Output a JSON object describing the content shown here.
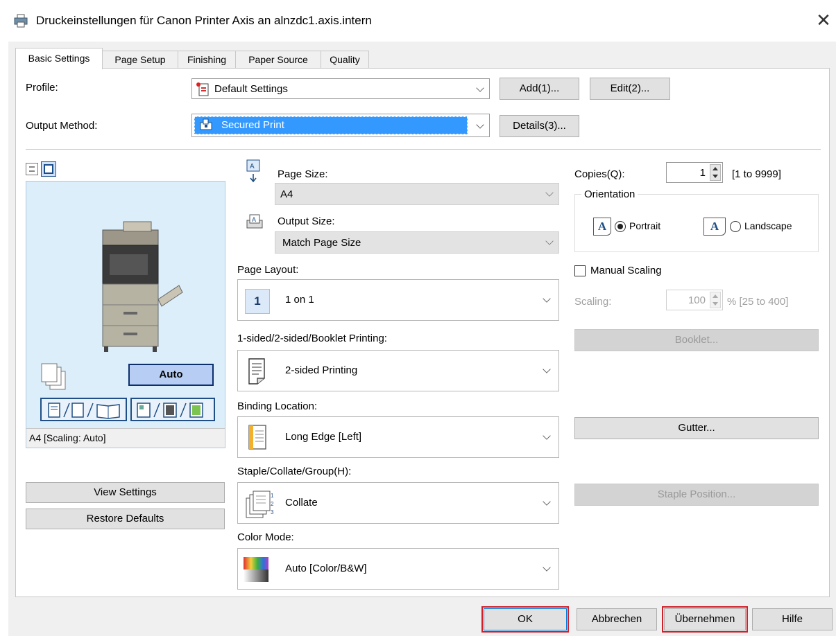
{
  "window": {
    "title": "Druckeinstellungen für Canon Printer Axis an alnzdc1.axis.intern",
    "close_label": "✕"
  },
  "tabs": [
    {
      "label": "Basic Settings",
      "active": true
    },
    {
      "label": "Page Setup"
    },
    {
      "label": "Finishing"
    },
    {
      "label": "Paper Source"
    },
    {
      "label": "Quality"
    }
  ],
  "profile": {
    "label": "Profile:",
    "value": "Default Settings",
    "add_button": "Add(1)...",
    "edit_button": "Edit(2)..."
  },
  "output_method": {
    "label": "Output Method:",
    "value": "Secured Print",
    "details_button": "Details(3)..."
  },
  "preview": {
    "auto_button": "Auto",
    "caption": "A4 [Scaling: Auto]",
    "view_settings_button": "View Settings",
    "restore_defaults_button": "Restore Defaults"
  },
  "page_size": {
    "label": "Page Size:",
    "value": "A4"
  },
  "output_size": {
    "label": "Output Size:",
    "value": "Match Page Size"
  },
  "page_layout": {
    "label": "Page Layout:",
    "value": "1 on 1",
    "icon_text": "1"
  },
  "printing_mode": {
    "label": "1-sided/2-sided/Booklet Printing:",
    "value": "2-sided Printing"
  },
  "binding": {
    "label": "Binding Location:",
    "value": "Long Edge [Left]"
  },
  "staple": {
    "label": "Staple/Collate/Group(H):",
    "value": "Collate"
  },
  "color_mode": {
    "label": "Color Mode:",
    "value": "Auto [Color/B&W]"
  },
  "copies": {
    "label": "Copies(Q):",
    "value": "1",
    "range": "[1 to 9999]"
  },
  "orientation": {
    "legend": "Orientation",
    "portrait": "Portrait",
    "landscape": "Landscape",
    "selected": "portrait",
    "icon_letter": "A"
  },
  "scaling": {
    "manual_label": "Manual Scaling",
    "manual_checked": false,
    "label": "Scaling:",
    "value": "100",
    "range": "% [25 to 400]"
  },
  "side_buttons": {
    "booklet": "Booklet...",
    "gutter": "Gutter...",
    "staple_position": "Staple Position..."
  },
  "footer": {
    "ok": "OK",
    "cancel": "Abbrechen",
    "apply": "Übernehmen",
    "help": "Hilfe"
  },
  "colors": {
    "highlight": "#3399ff",
    "preview_bg": "#dbeefa",
    "annotation_red": "#d0202a"
  }
}
